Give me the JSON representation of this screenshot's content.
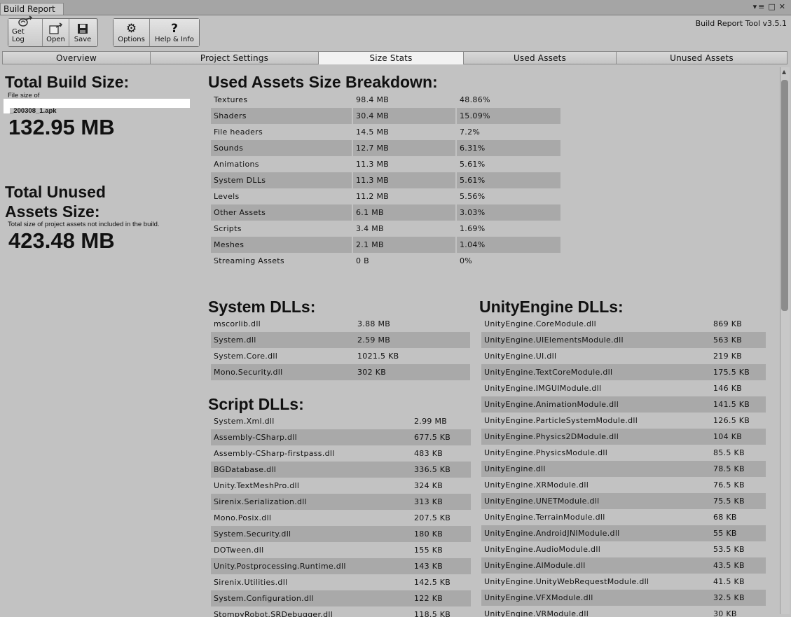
{
  "window": {
    "tab_title": "Build Report"
  },
  "toolbar": {
    "get_log": "Get Log",
    "open": "Open",
    "save": "Save",
    "options": "Options",
    "help_info": "Help & Info"
  },
  "version": "Build Report Tool v3.5.1",
  "tabs": [
    "Overview",
    "Project Settings",
    "Size Stats",
    "Used Assets",
    "Unused Assets"
  ],
  "left": {
    "total_build_title": "Total Build Size:",
    "file_size_of": "File size of",
    "file_name": "_200308_1.apk",
    "total_build_size": "132.95 MB",
    "unused_title_line1": "Total Unused",
    "unused_title_line2": "Assets Size:",
    "unused_desc": "Total size of project assets not included in the build.",
    "unused_size": "423.48 MB"
  },
  "breakdown": {
    "title": "Used Assets Size Breakdown:",
    "rows": [
      [
        "Textures",
        "98.4 MB",
        "48.86%"
      ],
      [
        "Shaders",
        "30.4 MB",
        "15.09%"
      ],
      [
        "File headers",
        "14.5 MB",
        "7.2%"
      ],
      [
        "Sounds",
        "12.7 MB",
        "6.31%"
      ],
      [
        "Animations",
        "11.3 MB",
        "5.61%"
      ],
      [
        "System DLLs",
        "11.3 MB",
        "5.61%"
      ],
      [
        "Levels",
        "11.2 MB",
        "5.56%"
      ],
      [
        "Other Assets",
        "6.1 MB",
        "3.03%"
      ],
      [
        "Scripts",
        "3.4 MB",
        "1.69%"
      ],
      [
        "Meshes",
        "2.1 MB",
        "1.04%"
      ],
      [
        "Streaming Assets",
        "0 B",
        "0%"
      ]
    ]
  },
  "system_dlls": {
    "title": "System DLLs:",
    "rows": [
      [
        "mscorlib.dll",
        "3.88 MB"
      ],
      [
        "System.dll",
        "2.59 MB"
      ],
      [
        "System.Core.dll",
        "1021.5 KB"
      ],
      [
        "Mono.Security.dll",
        "302 KB"
      ]
    ]
  },
  "script_dlls": {
    "title": "Script DLLs:",
    "rows": [
      [
        "System.Xml.dll",
        "2.99 MB"
      ],
      [
        "Assembly-CSharp.dll",
        "677.5 KB"
      ],
      [
        "Assembly-CSharp-firstpass.dll",
        "483 KB"
      ],
      [
        "BGDatabase.dll",
        "336.5 KB"
      ],
      [
        "Unity.TextMeshPro.dll",
        "324 KB"
      ],
      [
        "Sirenix.Serialization.dll",
        "313 KB"
      ],
      [
        "Mono.Posix.dll",
        "207.5 KB"
      ],
      [
        "System.Security.dll",
        "180 KB"
      ],
      [
        "DOTween.dll",
        "155 KB"
      ],
      [
        "Unity.Postprocessing.Runtime.dll",
        "143 KB"
      ],
      [
        "Sirenix.Utilities.dll",
        "142.5 KB"
      ],
      [
        "System.Configuration.dll",
        "122 KB"
      ],
      [
        "StompyRobot.SRDebugger.dll",
        "118.5 KB"
      ]
    ]
  },
  "unity_dlls": {
    "title": "UnityEngine DLLs:",
    "rows": [
      [
        "UnityEngine.CoreModule.dll",
        "869 KB"
      ],
      [
        "UnityEngine.UIElementsModule.dll",
        "563 KB"
      ],
      [
        "UnityEngine.UI.dll",
        "219 KB"
      ],
      [
        "UnityEngine.TextCoreModule.dll",
        "175.5 KB"
      ],
      [
        "UnityEngine.IMGUIModule.dll",
        "146 KB"
      ],
      [
        "UnityEngine.AnimationModule.dll",
        "141.5 KB"
      ],
      [
        "UnityEngine.ParticleSystemModule.dll",
        "126.5 KB"
      ],
      [
        "UnityEngine.Physics2DModule.dll",
        "104 KB"
      ],
      [
        "UnityEngine.PhysicsModule.dll",
        "85.5 KB"
      ],
      [
        "UnityEngine.dll",
        "78.5 KB"
      ],
      [
        "UnityEngine.XRModule.dll",
        "76.5 KB"
      ],
      [
        "UnityEngine.UNETModule.dll",
        "75.5 KB"
      ],
      [
        "UnityEngine.TerrainModule.dll",
        "68 KB"
      ],
      [
        "UnityEngine.AndroidJNIModule.dll",
        "55 KB"
      ],
      [
        "UnityEngine.AudioModule.dll",
        "53.5 KB"
      ],
      [
        "UnityEngine.AIModule.dll",
        "43.5 KB"
      ],
      [
        "UnityEngine.UnityWebRequestModule.dll",
        "41.5 KB"
      ],
      [
        "UnityEngine.VFXModule.dll",
        "32.5 KB"
      ],
      [
        "UnityEngine.VRModule.dll",
        "30 KB"
      ]
    ]
  }
}
